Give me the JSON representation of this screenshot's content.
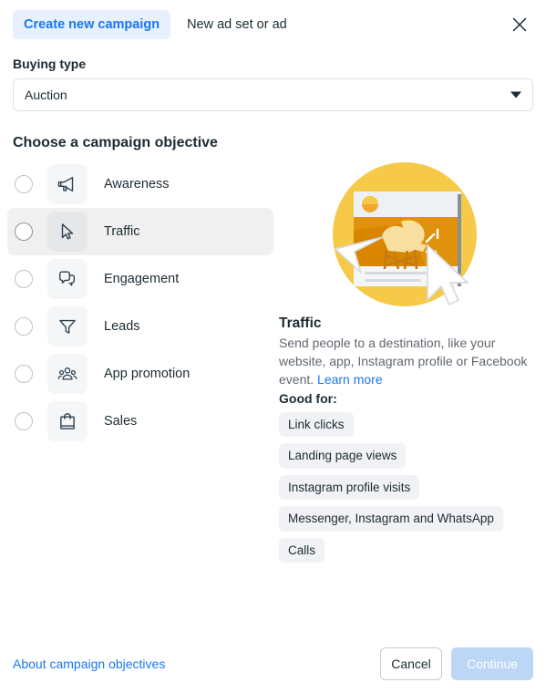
{
  "header": {
    "tab_create": "Create new campaign",
    "tab_new_adset": "New ad set or ad",
    "close_icon": "close-icon"
  },
  "buying_type": {
    "label": "Buying type",
    "value": "Auction",
    "caret_icon": "chevron-down-icon"
  },
  "objectives": {
    "heading": "Choose a campaign objective",
    "items": [
      {
        "label": "Awareness",
        "icon": "megaphone-icon",
        "selected": false
      },
      {
        "label": "Traffic",
        "icon": "cursor-icon",
        "selected": true
      },
      {
        "label": "Engagement",
        "icon": "chat-bubbles-icon",
        "selected": false
      },
      {
        "label": "Leads",
        "icon": "funnel-icon",
        "selected": false
      },
      {
        "label": "App promotion",
        "icon": "people-icon",
        "selected": false
      },
      {
        "label": "Sales",
        "icon": "shopping-bag-icon",
        "selected": false
      }
    ]
  },
  "detail": {
    "illustration_icon": "traffic-illustration",
    "title": "Traffic",
    "description": "Send people to a destination, like your website, app, Instagram profile or Facebook event. ",
    "learn_more": "Learn more",
    "good_for_label": "Good for:",
    "chips": [
      "Link clicks",
      "Landing page views",
      "Instagram profile visits",
      "Messenger, Instagram and WhatsApp",
      "Calls"
    ]
  },
  "footer": {
    "about_link": "About campaign objectives",
    "cancel": "Cancel",
    "continue": "Continue"
  },
  "colors": {
    "accent_blue": "#1877f2",
    "tab_bg": "#e7f0fd",
    "chip_bg": "#f0f2f5",
    "illustration_yellow": "#f7c948",
    "illustration_orange": "#e0920c"
  }
}
